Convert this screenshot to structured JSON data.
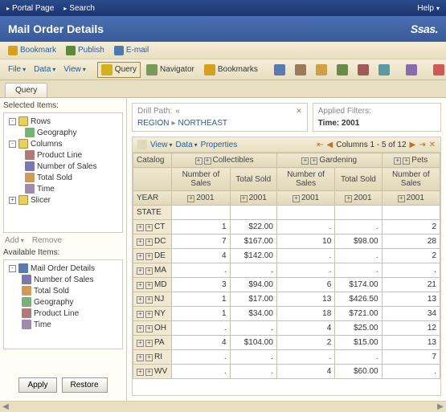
{
  "topbar": {
    "portal": "Portal Page",
    "search": "Search",
    "help": "Help"
  },
  "title": "Mail Order Details",
  "logo": "Ssas.",
  "linkbar": {
    "bookmark": "Bookmark",
    "publish": "Publish",
    "email": "E-mail"
  },
  "toolbar": {
    "file": "File",
    "data": "Data",
    "view": "View",
    "query": "Query",
    "navigator": "Navigator",
    "bookmarks": "Bookmarks"
  },
  "tab": "Query",
  "sidebar": {
    "selected_label": "Selected Items:",
    "available_label": "Available Items:",
    "add": "Add",
    "remove": "Remove",
    "apply": "Apply",
    "restore": "Restore",
    "selected": [
      {
        "indent": 0,
        "exp": "-",
        "icon": "i-folder",
        "label": "Rows"
      },
      {
        "indent": 20,
        "exp": "",
        "icon": "i-geo",
        "label": "Geography"
      },
      {
        "indent": 0,
        "exp": "-",
        "icon": "i-folder",
        "label": "Columns"
      },
      {
        "indent": 20,
        "exp": "",
        "icon": "i-prod",
        "label": "Product Line"
      },
      {
        "indent": 20,
        "exp": "",
        "icon": "i-num",
        "label": "Number of Sales"
      },
      {
        "indent": 20,
        "exp": "",
        "icon": "i-total",
        "label": "Total Sold"
      },
      {
        "indent": 20,
        "exp": "",
        "icon": "i-time",
        "label": "Time"
      },
      {
        "indent": 0,
        "exp": "+",
        "icon": "i-slicer",
        "label": "Slicer"
      }
    ],
    "available": [
      {
        "indent": 0,
        "exp": "-",
        "icon": "i-root",
        "label": "Mail Order Details"
      },
      {
        "indent": 16,
        "exp": "",
        "icon": "i-num",
        "label": "Number of Sales"
      },
      {
        "indent": 16,
        "exp": "",
        "icon": "i-total",
        "label": "Total Sold"
      },
      {
        "indent": 16,
        "exp": "",
        "icon": "i-geo",
        "label": "Geography"
      },
      {
        "indent": 16,
        "exp": "",
        "icon": "i-prod",
        "label": "Product Line"
      },
      {
        "indent": 16,
        "exp": "",
        "icon": "i-time",
        "label": "Time"
      }
    ]
  },
  "drill": {
    "label": "Drill Path:",
    "region": "REGION",
    "value": "NORTHEAST"
  },
  "filters": {
    "label": "Applied Filters:",
    "item": "Time: 2001"
  },
  "grid_toolbar": {
    "view": "View",
    "data": "Data",
    "properties": "Properties",
    "pager": "Columns 1 - 5 of 12"
  },
  "grid": {
    "corner_catalog": "Catalog",
    "col_groups": [
      "Collectibles",
      "Gardening",
      "Pets"
    ],
    "measure_nos": "Number of Sales",
    "measure_ts": "Total Sold",
    "year_label": "YEAR",
    "year_val": "2001",
    "state_label": "STATE",
    "rows": [
      {
        "state": "CT",
        "c_nos": "1",
        "c_ts": "$22.00",
        "g_nos": ".",
        "g_ts": ".",
        "p_nos": "2"
      },
      {
        "state": "DC",
        "c_nos": "7",
        "c_ts": "$167.00",
        "g_nos": "10",
        "g_ts": "$98.00",
        "p_nos": "28"
      },
      {
        "state": "DE",
        "c_nos": "4",
        "c_ts": "$142.00",
        "g_nos": ".",
        "g_ts": ".",
        "p_nos": "2"
      },
      {
        "state": "MA",
        "c_nos": ".",
        "c_ts": ".",
        "g_nos": ".",
        "g_ts": ".",
        "p_nos": "."
      },
      {
        "state": "MD",
        "c_nos": "3",
        "c_ts": "$94.00",
        "g_nos": "6",
        "g_ts": "$174.00",
        "p_nos": "21"
      },
      {
        "state": "NJ",
        "c_nos": "1",
        "c_ts": "$17.00",
        "g_nos": "13",
        "g_ts": "$426.50",
        "p_nos": "13"
      },
      {
        "state": "NY",
        "c_nos": "1",
        "c_ts": "$34.00",
        "g_nos": "18",
        "g_ts": "$721.00",
        "p_nos": "34"
      },
      {
        "state": "OH",
        "c_nos": ".",
        "c_ts": ".",
        "g_nos": "4",
        "g_ts": "$25.00",
        "p_nos": "12"
      },
      {
        "state": "PA",
        "c_nos": "4",
        "c_ts": "$104.00",
        "g_nos": "2",
        "g_ts": "$15.00",
        "p_nos": "13"
      },
      {
        "state": "RI",
        "c_nos": ".",
        "c_ts": ".",
        "g_nos": ".",
        "g_ts": ".",
        "p_nos": "7"
      },
      {
        "state": "WV",
        "c_nos": ".",
        "c_ts": ".",
        "g_nos": "4",
        "g_ts": "$60.00",
        "p_nos": "."
      }
    ]
  }
}
